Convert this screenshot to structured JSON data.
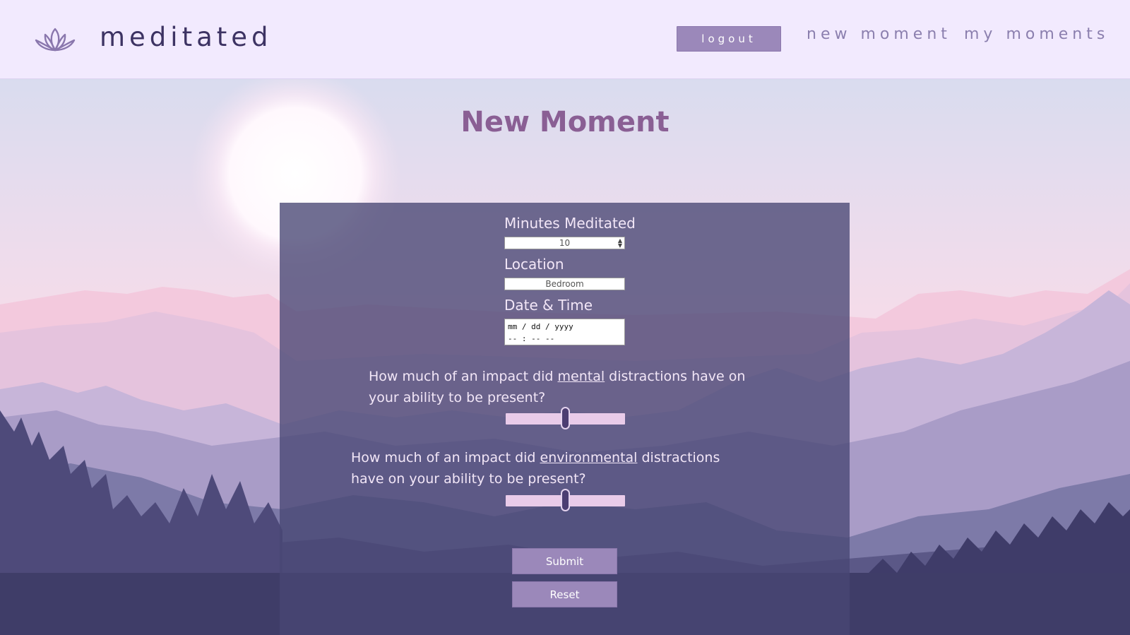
{
  "header": {
    "brand": "meditated",
    "logo_icon": "lotus-icon",
    "logout_label": "logout",
    "nav": {
      "new_moment": "new moment",
      "my_moments": "my moments"
    }
  },
  "page": {
    "title": "New Moment"
  },
  "form": {
    "minutes": {
      "label": "Minutes Meditated",
      "value": "10",
      "spinner_icon": "spinner-arrows-icon"
    },
    "location": {
      "label": "Location",
      "value": "Bedroom"
    },
    "datetime": {
      "label": "Date & Time",
      "date_placeholder": "mm / dd / yyyy",
      "time_placeholder": "-- : --  --"
    },
    "mental": {
      "prefix": "How much of an impact did ",
      "emphasis": "mental",
      "suffix": " distractions have on your ability to be present?",
      "slider_value": 0.5
    },
    "environmental": {
      "prefix": "How much of an impact did ",
      "emphasis": "environmental",
      "suffix": " distractions have on your ability to be present?",
      "slider_value": 0.5
    },
    "submit_label": "Submit",
    "reset_label": "Reset"
  },
  "colors": {
    "header_bg": "#f2eafe",
    "accent_button": "#9b88ba",
    "title": "#8a5f94",
    "panel": "#48467380"
  }
}
